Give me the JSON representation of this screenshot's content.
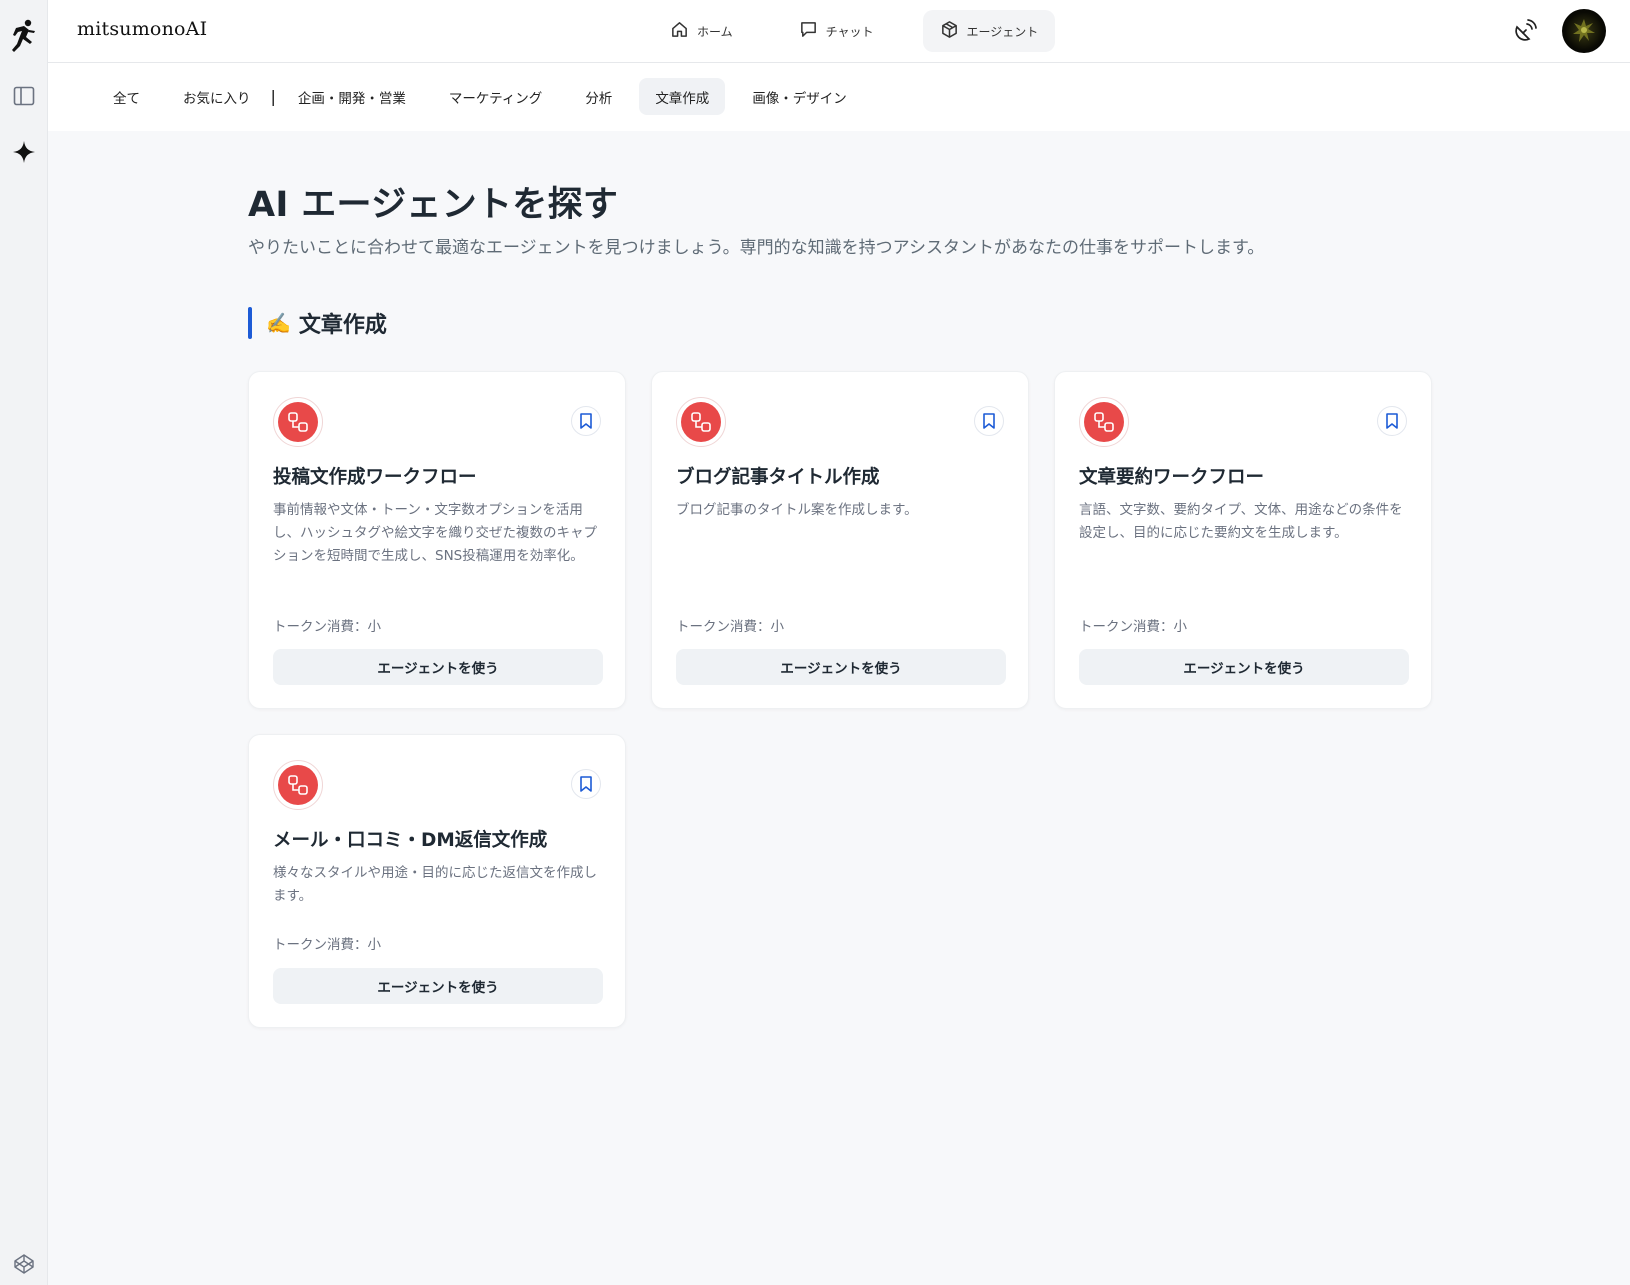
{
  "app": {
    "brand": "mitsumonoAI"
  },
  "rail": {
    "icons": [
      "runner-logo-icon",
      "sidebar-toggle-icon",
      "sparkle-icon",
      "codepen-icon"
    ]
  },
  "header": {
    "nav": [
      {
        "label": "ホーム",
        "icon": "home-icon",
        "active": false
      },
      {
        "label": "チャット",
        "icon": "chat-icon",
        "active": false
      },
      {
        "label": "エージェント",
        "icon": "cube-icon",
        "active": true
      }
    ],
    "right_icon": "satellite-dish-icon"
  },
  "categories": {
    "favorites_group": [
      "全て",
      "お気に入り"
    ],
    "separator": "|",
    "items": [
      "企画・開発・営業",
      "マーケティング",
      "分析",
      "文章作成",
      "画像・デザイン"
    ],
    "active": "文章作成"
  },
  "page": {
    "title": "AI エージェントを探す",
    "subtitle": "やりたいことに合わせて最適なエージェントを見つけましょう。専門的な知識を持つアシスタントがあなたの仕事をサポートします。"
  },
  "section": {
    "emoji": "✍️",
    "title": "文章作成",
    "accent_color": "#1d5bd6"
  },
  "agents": [
    {
      "title": "投稿文作成ワークフロー",
      "description": "事前情報や文体・トーン・文字数オプションを活用し、ハッシュタグや絵文字を織り交ぜた複数のキャプションを短時間で生成し、SNS投稿運用を効率化。",
      "token": "トークン消費：小",
      "button": "エージェントを使う",
      "icon": "workflow-icon"
    },
    {
      "title": "ブログ記事タイトル作成",
      "description": "ブログ記事のタイトル案を作成します。",
      "token": "トークン消費：小",
      "button": "エージェントを使う",
      "icon": "workflow-icon"
    },
    {
      "title": "文章要約ワークフロー",
      "description": "言語、文字数、要約タイプ、文体、用途などの条件を設定し、目的に応じた要約文を生成します。",
      "token": "トークン消費：小",
      "button": "エージェントを使う",
      "icon": "workflow-icon"
    },
    {
      "title": "メール・口コミ・DM返信文作成",
      "description": "様々なスタイルや用途・目的に応じた返信文を作成します。",
      "token": "トークン消費：小",
      "button": "エージェントを使う",
      "icon": "workflow-icon"
    }
  ],
  "colors": {
    "agent_icon_bg": "#e84949",
    "bookmark_blue": "#1d5bd6"
  }
}
